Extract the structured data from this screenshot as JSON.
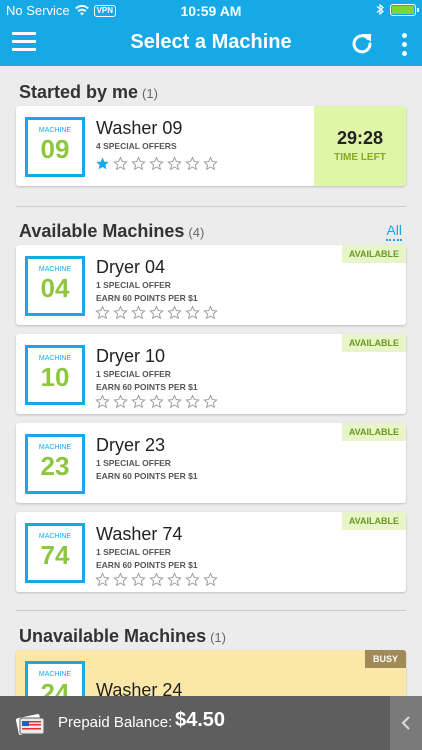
{
  "status_bar": {
    "carrier": "No Service",
    "vpn": "VPN",
    "time": "10:59 AM"
  },
  "nav": {
    "title": "Select a Machine"
  },
  "sections": {
    "started": {
      "title": "Started by me",
      "count": "(1)"
    },
    "available": {
      "title": "Available Machines",
      "count": "(4)",
      "all_link": "All"
    },
    "unavailable": {
      "title": "Unavailable Machines",
      "count": "(1)"
    }
  },
  "machine_label": "MACHINE",
  "started_machines": [
    {
      "name": "Washer 09",
      "number": "09",
      "offers": "4 SPECIAL OFFERS",
      "rating": 1,
      "time_left": "29:28",
      "time_label": "TIME LEFT"
    }
  ],
  "available_machines": [
    {
      "name": "Dryer 04",
      "number": "04",
      "offers": "1 SPECIAL OFFER",
      "points": "EARN 60 POINTS PER $1",
      "status": "AVAILABLE",
      "rating": 0
    },
    {
      "name": "Dryer 10",
      "number": "10",
      "offers": "1 SPECIAL OFFER",
      "points": "EARN 60 POINTS PER $1",
      "status": "AVAILABLE",
      "rating": 0
    },
    {
      "name": "Dryer 23",
      "number": "23",
      "offers": "1 SPECIAL OFFER",
      "points": "EARN 60 POINTS PER $1",
      "status": "AVAILABLE",
      "rating": 0
    },
    {
      "name": "Washer 74",
      "number": "74",
      "offers": "1 SPECIAL OFFER",
      "points": "EARN 60 POINTS PER $1",
      "status": "AVAILABLE",
      "rating": 0
    }
  ],
  "unavailable_machines": [
    {
      "name": "Washer 24",
      "number": "24",
      "status": "BUSY"
    }
  ],
  "footer": {
    "label": "Prepaid Balance:",
    "balance": "$4.50"
  },
  "colors": {
    "primary": "#17a9e6",
    "number_green": "#8dc63f",
    "available_bg": "#e8f5c8",
    "time_bg": "#dff5a8",
    "busy_bg": "#fbe7a8",
    "busy_tag": "#a08a55",
    "footer_bg": "#5e5e5e"
  },
  "icons": {
    "menu": "hamburger-icon",
    "refresh": "refresh-icon",
    "more": "more-vertical-icon",
    "star": "star-icon",
    "card": "credit-card-icon",
    "collapse": "chevron-left-icon"
  }
}
